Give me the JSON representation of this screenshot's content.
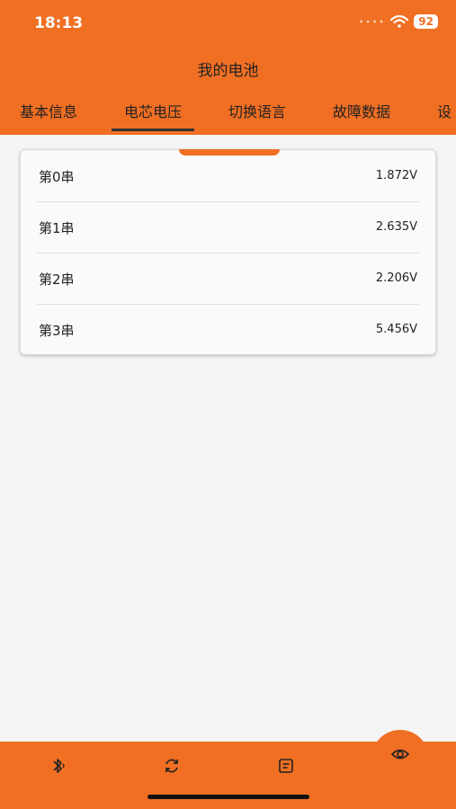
{
  "status": {
    "time": "18:13",
    "battery": "92"
  },
  "header": {
    "title": "我的电池"
  },
  "tabs": [
    {
      "label": "基本信息"
    },
    {
      "label": "电芯电压"
    },
    {
      "label": "切换语言"
    },
    {
      "label": "故障数据"
    },
    {
      "label": "设"
    }
  ],
  "cells": [
    {
      "label": "第0串",
      "value": "1.872V"
    },
    {
      "label": "第1串",
      "value": "2.635V"
    },
    {
      "label": "第2串",
      "value": "2.206V"
    },
    {
      "label": "第3串",
      "value": "5.456V"
    }
  ],
  "colors": {
    "accent": "#f06f23",
    "background": "#f4f4f4"
  },
  "bottom_nav": [
    {
      "icon": "bluetooth-icon"
    },
    {
      "icon": "refresh-icon"
    },
    {
      "icon": "document-icon"
    },
    {
      "icon": "eye-icon"
    }
  ]
}
